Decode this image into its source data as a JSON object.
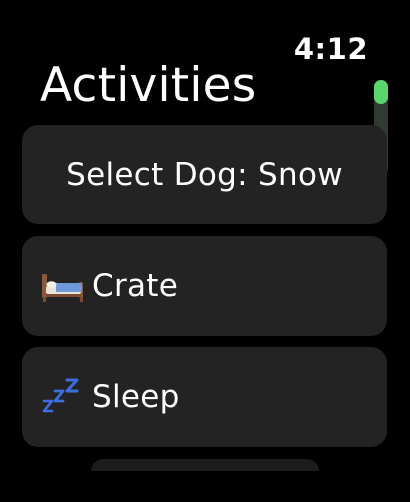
{
  "status": {
    "time": "4:12"
  },
  "header": {
    "title": "Activities"
  },
  "list": {
    "select_dog": {
      "label": "Select Dog: Snow"
    },
    "items": [
      {
        "label": "Crate",
        "icon": "bed-icon"
      },
      {
        "label": "Sleep",
        "icon": "zzz-icon"
      }
    ]
  },
  "colors": {
    "background": "#000000",
    "card": "#232323",
    "scroll_thumb": "#5bd66b",
    "zzz": "#3b6fe0"
  }
}
